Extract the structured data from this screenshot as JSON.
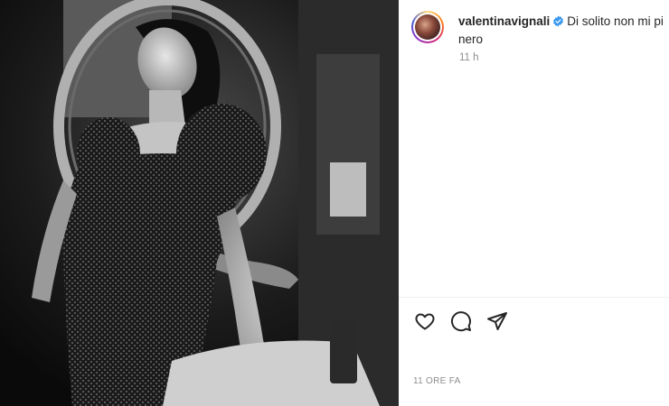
{
  "post": {
    "username": "valentinavignali",
    "caption": "Di solito non mi pi",
    "caption_line2": "nero",
    "comment_time": "11 h",
    "date": "11 ORE FA"
  },
  "icons": {
    "verified": "verified-badge-icon",
    "like": "heart-icon",
    "comment": "comment-icon",
    "share": "send-icon"
  },
  "colors": {
    "verified_blue": "#3897f0",
    "text": "#262626",
    "muted": "#8e8e8e"
  }
}
